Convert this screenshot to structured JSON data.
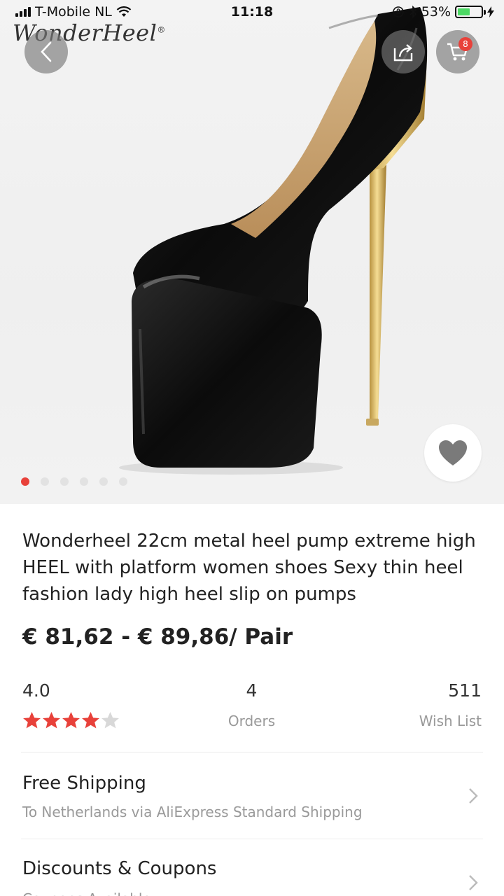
{
  "status_bar": {
    "carrier": "T-Mobile NL",
    "time": "11:18",
    "battery": "53%",
    "battery_level": 0.53,
    "battery_color": "#4cd964"
  },
  "brand": {
    "name": "WonderHeel",
    "mark": "®"
  },
  "header": {
    "back_icon": "chevron-left-icon",
    "share_icon": "share-icon",
    "cart_icon": "cart-icon",
    "cart_count": "8"
  },
  "gallery": {
    "image_count": 6,
    "active_index": 0
  },
  "product": {
    "title": "Wonderheel 22cm metal heel pump extreme high HEEL with platform women shoes Sexy thin heel fashion lady high heel slip on pumps",
    "price": "€ 81,62 - € 89,86/ Pair"
  },
  "stats": {
    "rating": "4.0",
    "rating_value": 4,
    "rating_max": 5,
    "orders_count": "4",
    "orders_label": "Orders",
    "wishlist_count": "511",
    "wishlist_label": "Wish List"
  },
  "shipping": {
    "title": "Free Shipping",
    "subtitle": "To Netherlands via AliExpress Standard Shipping"
  },
  "discounts": {
    "title": "Discounts & Coupons",
    "subtitle": "Coupons Available"
  },
  "colors": {
    "accent": "#e8413a",
    "star_empty": "#d8d8d8",
    "muted_text": "#999999"
  }
}
